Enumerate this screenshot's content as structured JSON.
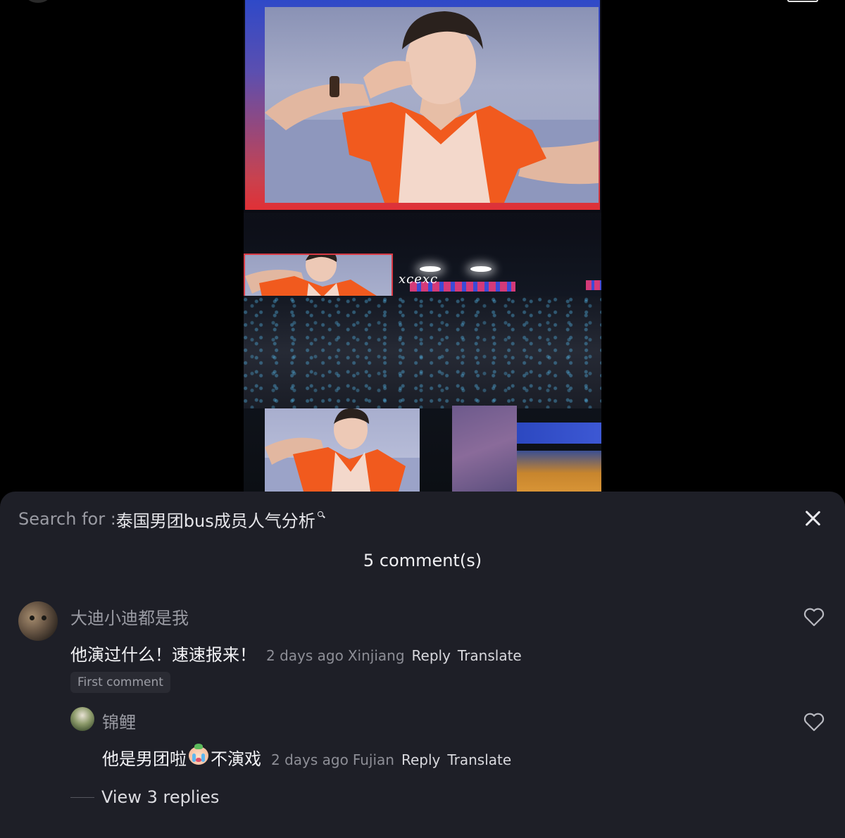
{
  "video": {
    "watermark": "xcexc"
  },
  "search": {
    "prefix": "Search for : ",
    "query": "泰国男团bus成员人气分析"
  },
  "sheet": {
    "comment_count": "5 comment(s)"
  },
  "comments": [
    {
      "username": "大迪小迪都是我",
      "text": "他演过什么！速速报来！",
      "time": "2 days ago",
      "location": "Xinjiang",
      "reply_label": "Reply",
      "translate_label": "Translate",
      "badge": "First comment"
    },
    {
      "username": "锦鲤",
      "text_before": "他是男团啦",
      "text_after": "不演戏",
      "emoji": "crying-face-emoji",
      "time": "2 days ago",
      "location": "Fujian",
      "reply_label": "Reply",
      "translate_label": "Translate"
    }
  ],
  "view_replies": "View 3 replies",
  "icons": {
    "close": "close-icon",
    "like": "heart-outline-icon",
    "search": "search-icon"
  },
  "colors": {
    "sheet_background": "#1e1f27",
    "muted_text": "#9a9ba3",
    "primary_text": "#f3f3f6"
  }
}
